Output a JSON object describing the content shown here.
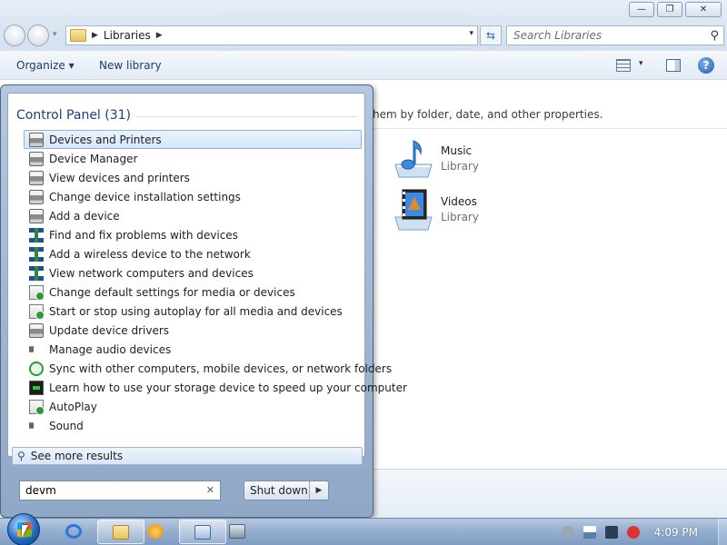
{
  "window": {
    "controls": {
      "minimize": "—",
      "maximize": "❐",
      "close": "✕"
    }
  },
  "address": {
    "location": "Libraries",
    "refresh_icon": "refresh-icon",
    "search_placeholder": "Search Libraries"
  },
  "toolbar": {
    "organize_label": "Organize ▾",
    "new_library_label": "New library",
    "help_label": "?"
  },
  "content": {
    "hint": "hem by folder, date, and other properties.",
    "libraries": [
      {
        "name": "Music",
        "sub": "Library",
        "icon": "music-library-icon"
      },
      {
        "name": "Videos",
        "sub": "Library",
        "icon": "videos-library-icon"
      }
    ]
  },
  "start_menu": {
    "header": "Control Panel (31)",
    "results": [
      {
        "label": "Devices and Printers",
        "icon": "printer-icon",
        "selected": true
      },
      {
        "label": "Device Manager",
        "icon": "printer-icon"
      },
      {
        "label": "View devices and printers",
        "icon": "printer-icon"
      },
      {
        "label": "Change device installation settings",
        "icon": "printer-icon"
      },
      {
        "label": "Add a device",
        "icon": "printer-icon"
      },
      {
        "label": "Find and fix problems with devices",
        "icon": "network-icon"
      },
      {
        "label": "Add a wireless device to the network",
        "icon": "network-icon"
      },
      {
        "label": "View network computers and devices",
        "icon": "network-icon"
      },
      {
        "label": "Change default settings for media or devices",
        "icon": "media-icon"
      },
      {
        "label": "Start or stop using autoplay for all media and devices",
        "icon": "media-icon"
      },
      {
        "label": "Update device drivers",
        "icon": "printer-icon"
      },
      {
        "label": "Manage audio devices",
        "icon": "audio-icon"
      },
      {
        "label": "Sync with other computers, mobile devices, or network folders",
        "icon": "sync-icon"
      },
      {
        "label": "Learn how to use your storage device to speed up your computer",
        "icon": "storage-icon"
      },
      {
        "label": "AutoPlay",
        "icon": "media-icon"
      },
      {
        "label": "Sound",
        "icon": "audio-icon"
      }
    ],
    "see_more": "See more results",
    "search_value": "devm",
    "search_clear": "✕",
    "shutdown_label": "Shut down",
    "shutdown_arrow": "▶"
  },
  "taskbar": {
    "clock": "4:09 PM",
    "pinned": [
      "internet-explorer-icon",
      "windows-explorer-icon",
      "media-player-icon",
      "control-panel-icon",
      "device-manager-icon"
    ]
  }
}
